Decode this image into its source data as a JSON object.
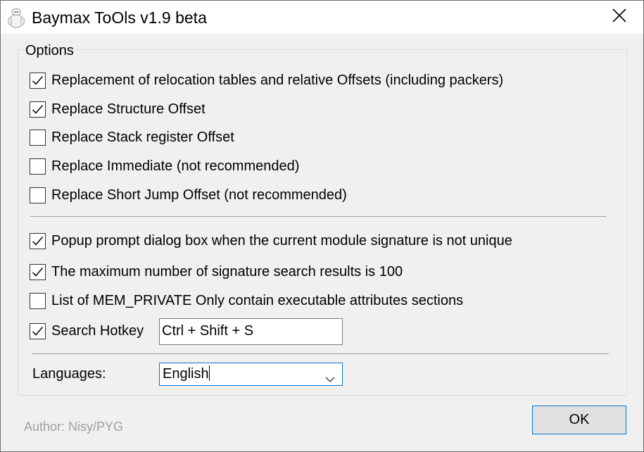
{
  "window": {
    "title": "Baymax ToOls v1.9 beta",
    "icon": "baymax-app-icon",
    "close_icon": "close-icon"
  },
  "options": {
    "group_label": "Options",
    "items": [
      {
        "label": "Replacement of relocation tables and relative Offsets (including packers)",
        "checked": true
      },
      {
        "label": "Replace Structure Offset",
        "checked": true
      },
      {
        "label": "Replace Stack register Offset",
        "checked": false
      },
      {
        "label": "Replace Immediate (not recommended)",
        "checked": false
      },
      {
        "label": "Replace Short Jump Offset (not recommended)",
        "checked": false
      },
      {
        "label": "Popup prompt dialog box when the current module signature is not unique",
        "checked": true
      },
      {
        "label": "The maximum number of signature search results is 100",
        "checked": true
      },
      {
        "label": "List of MEM_PRIVATE Only contain executable attributes sections",
        "checked": false
      },
      {
        "label": "Search Hotkey",
        "checked": true
      }
    ],
    "hotkey_value": "Ctrl + Shift + S"
  },
  "languages": {
    "label": "Languages:",
    "selected": "English"
  },
  "footer": {
    "author": "Author: Nisy/PYG",
    "ok_label": "OK"
  },
  "colors": {
    "accent": "#0078d7",
    "window_bg": "#f0f0f0",
    "titlebar_bg": "#ffffff",
    "disabled_text": "#a0a0a0"
  }
}
